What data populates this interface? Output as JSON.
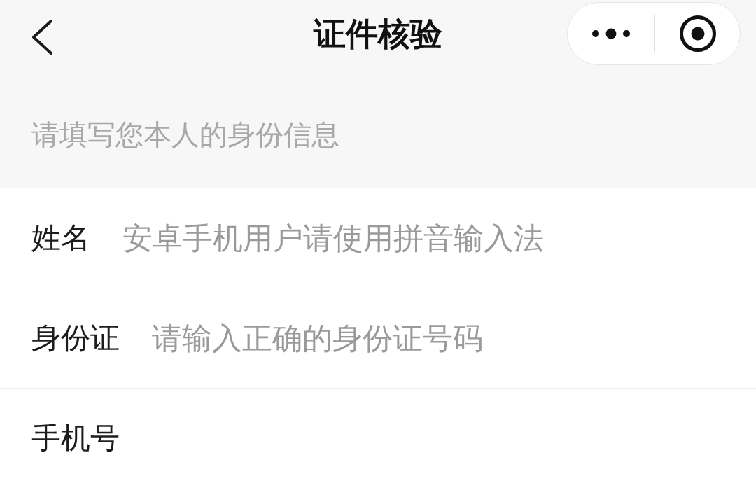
{
  "nav_bar": {
    "title": "证件核验"
  },
  "subtitle": "请填写您本人的身份信息",
  "form": {
    "fields": [
      {
        "label": "姓名",
        "placeholder": "安卓手机用户请使用拼音输入法"
      },
      {
        "label": "身份证",
        "placeholder": "请输入正确的身份证号码"
      },
      {
        "label": "手机号"
      }
    ]
  }
}
